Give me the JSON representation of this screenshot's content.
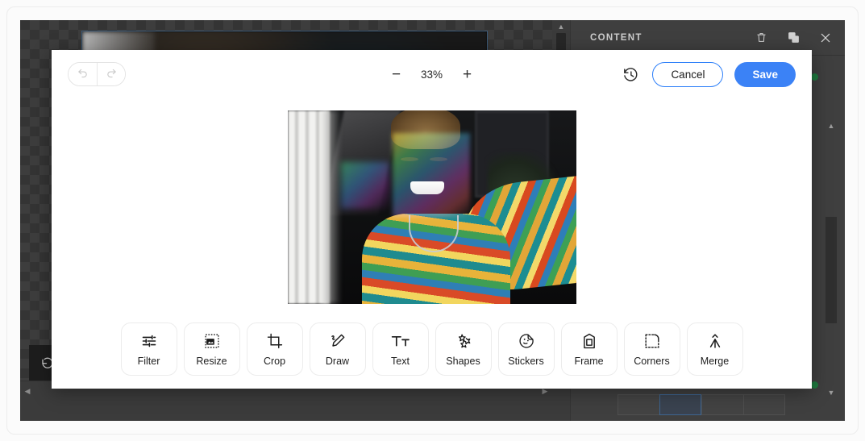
{
  "background_app": {
    "right_panel": {
      "title": "CONTENT",
      "header_icons": [
        {
          "name": "delete-icon",
          "glyph": "trash"
        },
        {
          "name": "duplicate-icon",
          "glyph": "copy"
        },
        {
          "name": "close-icon",
          "glyph": "times"
        }
      ]
    },
    "mini_toolbar": {
      "icons": [
        {
          "name": "undo-icon"
        },
        {
          "name": "redo-icon"
        },
        {
          "name": "preview-eye-icon"
        },
        {
          "name": "desktop-view-icon"
        },
        {
          "name": "mobile-view-icon"
        }
      ]
    },
    "scrollbars": {
      "h_left_arrow": "◀",
      "h_right_arrow": "▶",
      "v_up_arrow": "▲",
      "v_down_arrow": "▼"
    }
  },
  "image_editor": {
    "history": {
      "undo_label": "Undo",
      "redo_label": "Redo",
      "undo_icon": "undo-icon",
      "redo_icon": "redo-icon",
      "restore_icon": "history-restore-icon"
    },
    "zoom": {
      "minus_label": "−",
      "value": "33%",
      "plus_label": "+"
    },
    "actions": {
      "cancel_label": "Cancel",
      "save_label": "Save"
    },
    "canvas": {
      "photo_alt": "Smiling person in rainbow striped shirt taking a selfie with prism light"
    },
    "tools": [
      {
        "label": "Filter",
        "icon": "sliders-icon"
      },
      {
        "label": "Resize",
        "icon": "resize-image-icon"
      },
      {
        "label": "Crop",
        "icon": "crop-icon"
      },
      {
        "label": "Draw",
        "icon": "pencil-draw-icon"
      },
      {
        "label": "Text",
        "icon": "text-tt-icon"
      },
      {
        "label": "Shapes",
        "icon": "puzzle-shape-icon"
      },
      {
        "label": "Stickers",
        "icon": "sticker-face-icon"
      },
      {
        "label": "Frame",
        "icon": "frame-icon"
      },
      {
        "label": "Corners",
        "icon": "rounded-corners-icon"
      },
      {
        "label": "Merge",
        "icon": "merge-arrows-icon"
      }
    ]
  },
  "colors": {
    "accent_blue": "#3b82f6",
    "cancel_border": "#2d7ff9",
    "panel_dark": "#3f3f3f",
    "canvas_dark": "#343434",
    "modal_white": "#ffffff"
  }
}
